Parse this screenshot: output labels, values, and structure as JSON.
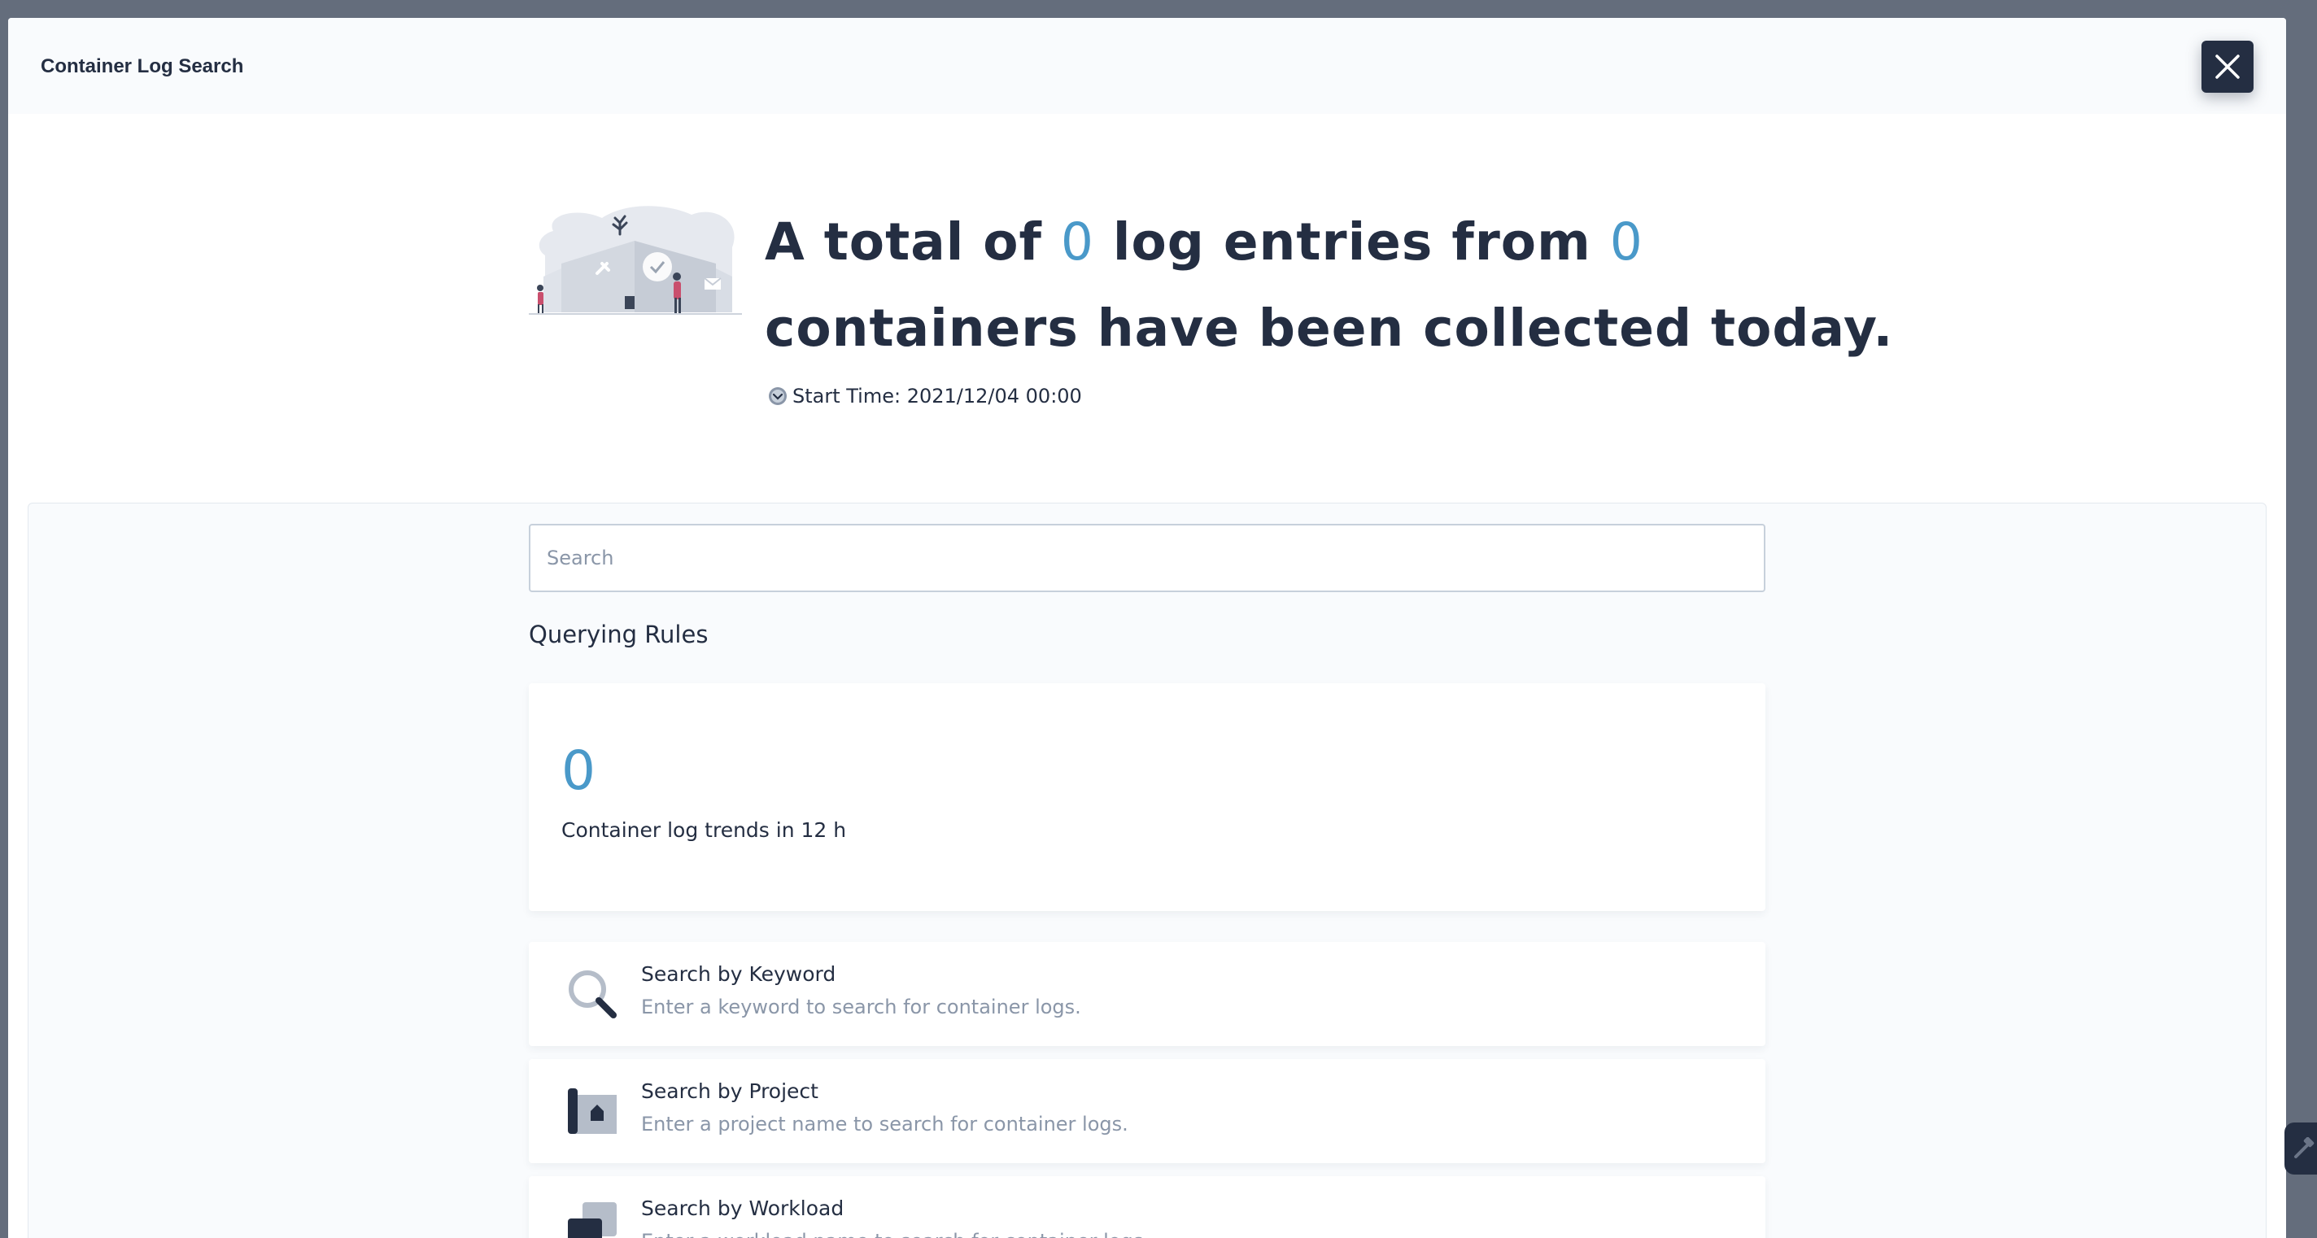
{
  "modal": {
    "title": "Container Log Search",
    "close_icon": "close-icon"
  },
  "hero": {
    "line1_before": "A total of",
    "entries_count": "0",
    "line1_middle": "log entries from",
    "containers_count": "0",
    "line2": "containers have been collected today.",
    "start_time_label": "Start Time: 2021/12/04 00:00",
    "illustration_icon": "log-collection-illustration",
    "clock_icon": "clock-icon"
  },
  "search": {
    "placeholder": "Search",
    "value": ""
  },
  "querying_rules": {
    "heading": "Querying Rules",
    "trend": {
      "count": "0",
      "label": "Container log trends in 12 h"
    },
    "rules": [
      {
        "icon": "magnifier-icon",
        "title": "Search by Keyword",
        "description": "Enter a keyword to search for container logs."
      },
      {
        "icon": "project-icon",
        "title": "Search by Project",
        "description": "Enter a project name to search for container logs."
      },
      {
        "icon": "workload-icon",
        "title": "Search by Workload",
        "description": "Enter a workload name to search for container logs."
      }
    ]
  },
  "colors": {
    "accent": "#4a99c9",
    "text_primary": "#242e42",
    "text_secondary": "#8a96a8",
    "overlay": "#646d7c",
    "header_bg": "#f9fbfd"
  },
  "side_tool": {
    "icon": "hammer-icon"
  }
}
